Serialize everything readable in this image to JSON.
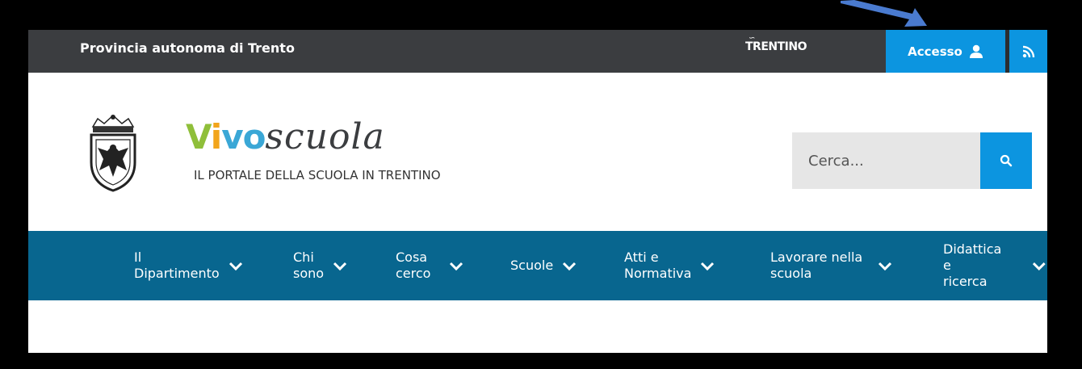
{
  "topbar": {
    "org": "Provincia autonoma di Trento",
    "trentino_logo": "TRENTINO",
    "login_label": "Accesso",
    "login_icon": "user-icon",
    "rss_icon": "rss-icon"
  },
  "brand": {
    "part1": "V",
    "part2": "i",
    "part3": "vo",
    "part4": "scuola",
    "subtitle": "IL PORTALE DELLA SCUOLA IN TRENTINO"
  },
  "search": {
    "placeholder": "Cerca...",
    "icon": "search-icon"
  },
  "nav": {
    "items": [
      {
        "label": "Il\nDipartimento"
      },
      {
        "label": "Chi\nsono"
      },
      {
        "label": "Cosa\ncerco"
      },
      {
        "label": "Scuole"
      },
      {
        "label": "Atti e\nNormativa"
      },
      {
        "label": "Lavorare nella\nscuola"
      },
      {
        "label": "Didattica e\nricerca"
      }
    ]
  },
  "colors": {
    "accent": "#0c95e0",
    "topbar": "#3b3d40",
    "nav": "#08668f",
    "annotation_arrow": "#4a7bd0"
  }
}
